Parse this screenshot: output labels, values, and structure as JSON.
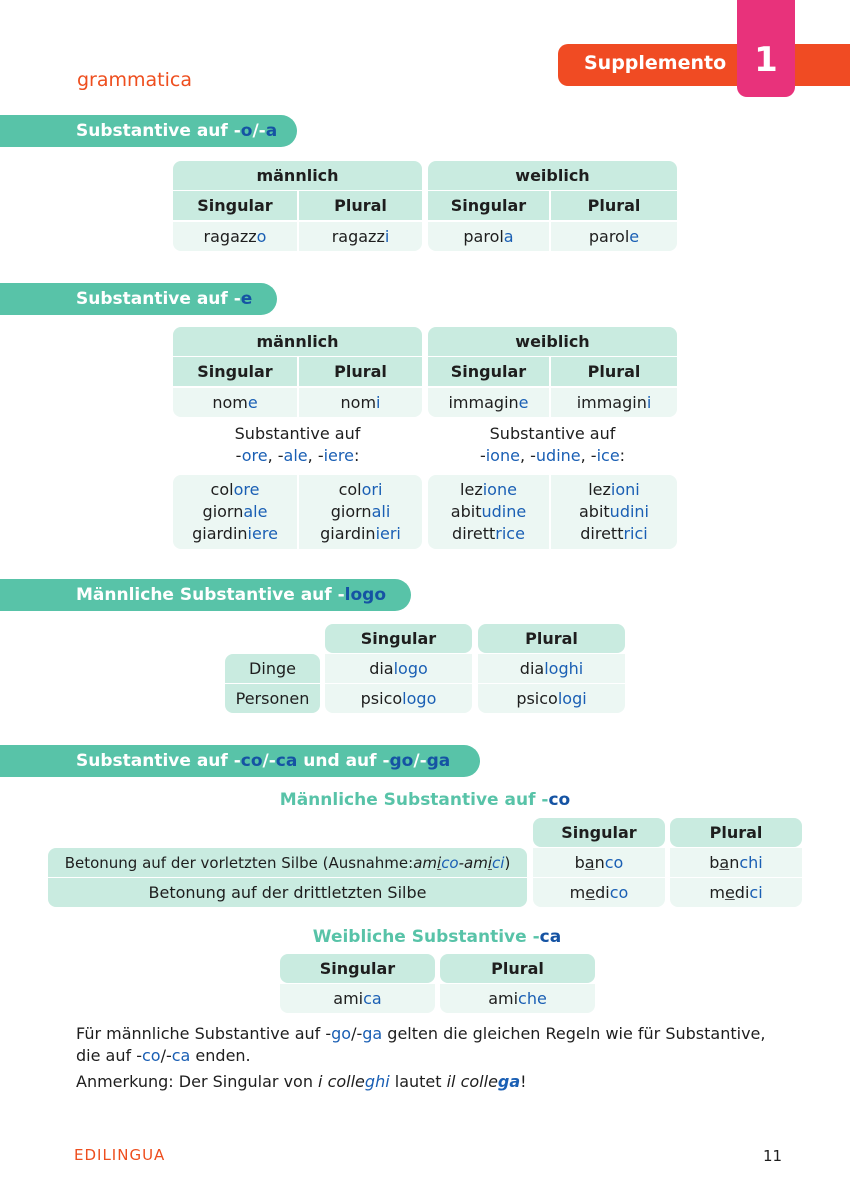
{
  "header": {
    "section": "grammatica",
    "supplement_label": "Supplemento",
    "supplement_number": "1"
  },
  "s1": {
    "title_pre": "Substantive auf -",
    "title_e1": "o",
    "title_mid": "/-",
    "title_e2": "a",
    "col_m": "männlich",
    "col_f": "weiblich",
    "singular": "Singular",
    "plural": "Plural",
    "rows": [
      {
        "m_sg": [
          "ragazz",
          "o"
        ],
        "m_pl": [
          "ragazz",
          "i"
        ],
        "f_sg": [
          "parol",
          "a"
        ],
        "f_pl": [
          "parol",
          "e"
        ]
      }
    ]
  },
  "s2": {
    "title_pre": "Substantive auf -",
    "title_e1": "e",
    "col_m": "männlich",
    "col_f": "weiblich",
    "singular": "Singular",
    "plural": "Plural",
    "row": {
      "m_sg": [
        "nom",
        "e"
      ],
      "m_pl": [
        "nom",
        "i"
      ],
      "f_sg": [
        "immagin",
        "e"
      ],
      "f_pl": [
        "immagin",
        "i"
      ]
    },
    "note_m_line1": "Substantive auf",
    "note_m_line2": [
      "-",
      "ore",
      ", -",
      "ale",
      ", -",
      "iere",
      ":"
    ],
    "note_f_line1": "Substantive auf",
    "note_f_line2": [
      "-",
      "ione",
      ", -",
      "udine",
      ", -",
      "ice",
      ":"
    ],
    "m_sg": [
      [
        "col",
        "ore"
      ],
      [
        "giorn",
        "ale"
      ],
      [
        "giardin",
        "iere"
      ]
    ],
    "m_pl": [
      [
        "col",
        "ori"
      ],
      [
        "giorn",
        "ali"
      ],
      [
        "giardin",
        "ieri"
      ]
    ],
    "f_sg": [
      [
        "lez",
        "ione"
      ],
      [
        "abit",
        "udine"
      ],
      [
        "dirett",
        "rice"
      ]
    ],
    "f_pl": [
      [
        "lez",
        "ioni"
      ],
      [
        "abit",
        "udini"
      ],
      [
        "dirett",
        "rici"
      ]
    ]
  },
  "s3": {
    "title_pre": "Männliche Substantive auf -",
    "title_e1": "logo",
    "singular": "Singular",
    "plural": "Plural",
    "rows": [
      {
        "label": "Dinge",
        "sg": [
          "dia",
          "logo"
        ],
        "pl": [
          "dia",
          "loghi"
        ]
      },
      {
        "label": "Personen",
        "sg": [
          "psico",
          "logo"
        ],
        "pl": [
          "psico",
          "logi"
        ]
      }
    ]
  },
  "s4": {
    "title_pre": "Substantive auf -",
    "t1": "co",
    "t2": "/-",
    "t3": "ca",
    "t4": " und auf -",
    "t5": "go",
    "t6": "/-",
    "t7": "ga",
    "sub_m_pre": "Männliche Substantive auf -",
    "sub_m_hl": "co",
    "singular": "Singular",
    "plural": "Plural",
    "row1_label": [
      "Betonung auf der vorletzten Silbe (Ausnahme: ",
      "am",
      "i",
      "co",
      "-am",
      "i",
      "ci",
      ")"
    ],
    "row1_sg": [
      "b",
      "a",
      "n",
      "co"
    ],
    "row1_pl": [
      "b",
      "a",
      "n",
      "chi"
    ],
    "row2_label": "Betonung auf der drittletzten Silbe",
    "row2_sg": [
      "m",
      "e",
      "di",
      "co"
    ],
    "row2_pl": [
      "m",
      "e",
      "di",
      "ci"
    ],
    "sub_f_pre": "Weibliche Substantive -",
    "sub_f_hl": "ca",
    "f_sg": [
      "ami",
      "ca"
    ],
    "f_pl": [
      "ami",
      "che"
    ],
    "para1": [
      "Für männliche Substantive auf -",
      "go",
      "/-",
      "ga",
      " gelten die gleichen Regeln wie für Substantive,"
    ],
    "para1b": [
      "die auf -",
      "co",
      "/-",
      "ca",
      " enden."
    ],
    "para2": [
      "Anmerkung: Der Singular von ",
      "i colle",
      "ghi",
      " lautet ",
      "il colle",
      "ga",
      "!"
    ]
  },
  "footer": {
    "brand": "EDILINGUA",
    "page": "11"
  },
  "colors": {
    "accent_orange": "#f04b23",
    "accent_pink": "#e8327b",
    "teal": "#58c3a8",
    "header_cell": "#c9ebe0",
    "data_cell": "#ecf7f3",
    "ending_blue": "#1a5fb4"
  }
}
